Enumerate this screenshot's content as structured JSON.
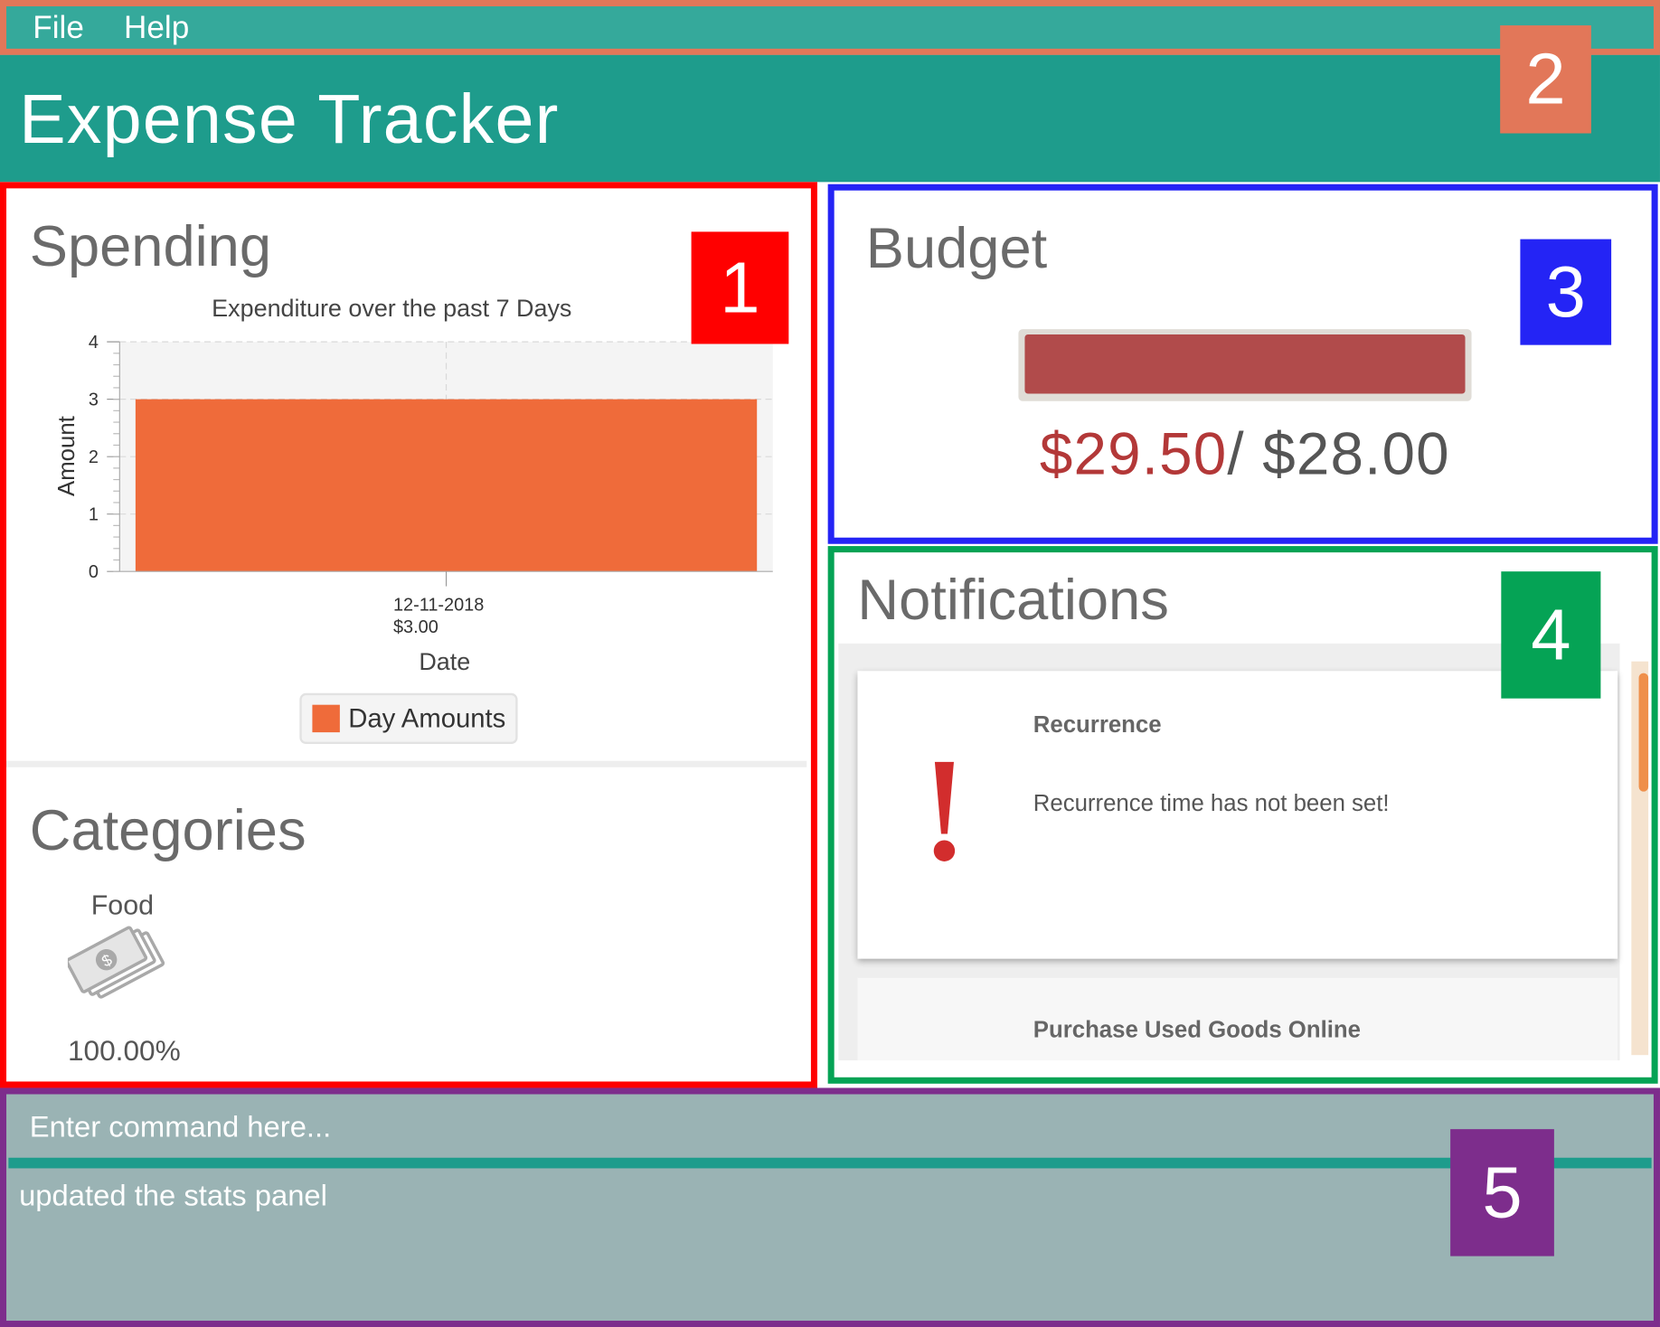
{
  "menu": {
    "items": [
      "File",
      "Help"
    ]
  },
  "app": {
    "title": "Expense Tracker"
  },
  "annotations": [
    {
      "label": "1",
      "color": "#ff0000"
    },
    {
      "label": "2",
      "color": "#e27759"
    },
    {
      "label": "3",
      "color": "#2424f5"
    },
    {
      "label": "4",
      "color": "#05a355"
    },
    {
      "label": "5",
      "color": "#7d2d8c"
    }
  ],
  "spending": {
    "title": "Spending",
    "chart_title": "Expenditure over the past 7 Days",
    "legend_label": "Day Amounts"
  },
  "chart_data": {
    "type": "bar",
    "title": "Expenditure over the past 7 Days",
    "xlabel": "Date",
    "ylabel": "Amount",
    "ylim": [
      0,
      4
    ],
    "yticks": [
      "0",
      "1",
      "2",
      "3",
      "4"
    ],
    "categories": [
      "12-11-2018"
    ],
    "category_sublabels": [
      "$3.00"
    ],
    "series": [
      {
        "name": "Day Amounts",
        "values": [
          3
        ],
        "color": "#ef6b3a"
      }
    ],
    "grid": true,
    "legend_position": "bottom"
  },
  "categories": {
    "title": "Categories",
    "items": [
      {
        "label": "Food",
        "percent": "100.00%",
        "icon": "money-icon"
      }
    ]
  },
  "budget": {
    "title": "Budget",
    "spent": "$29.50",
    "separator": "/ ",
    "total": "$28.00",
    "fill_fraction": 1.0,
    "bar_color": "#b14b4b"
  },
  "notifications": {
    "title": "Notifications",
    "items": [
      {
        "title": "Recurrence",
        "text": "Recurrence time has not been set!",
        "icon": "exclamation-icon"
      },
      {
        "title": "Purchase Used Goods Online",
        "text": ""
      }
    ]
  },
  "command": {
    "placeholder": "Enter command here...",
    "result": "updated the stats panel"
  }
}
